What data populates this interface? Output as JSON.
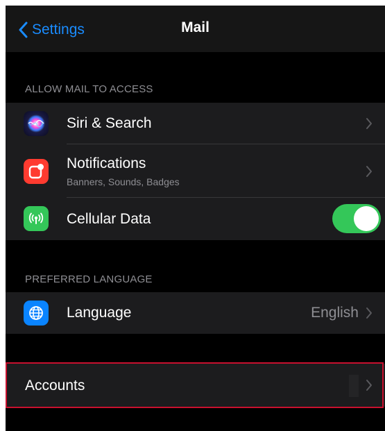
{
  "navbar": {
    "back_label": "Settings",
    "title": "Mail"
  },
  "sections": {
    "allow_access": {
      "header": "ALLOW MAIL TO ACCESS",
      "rows": {
        "siri": {
          "label": "Siri & Search",
          "icon": "siri-icon"
        },
        "notifications": {
          "label": "Notifications",
          "sublabel": "Banners, Sounds, Badges",
          "icon": "notifications-icon"
        },
        "cellular": {
          "label": "Cellular Data",
          "icon": "cellular-icon",
          "toggle_on": true
        }
      }
    },
    "preferred_language": {
      "header": "PREFERRED LANGUAGE",
      "rows": {
        "language": {
          "label": "Language",
          "value": "English",
          "icon": "globe-icon"
        }
      }
    },
    "accounts": {
      "rows": {
        "accounts": {
          "label": "Accounts"
        }
      }
    }
  },
  "colors": {
    "accent_blue": "#1a8cff",
    "toggle_green": "#34c759",
    "notifications_red": "#ff3b30",
    "globe_blue": "#0a84ff",
    "highlight_red": "#c8102e",
    "background": "#000000",
    "cell_background": "#1c1c1e"
  }
}
